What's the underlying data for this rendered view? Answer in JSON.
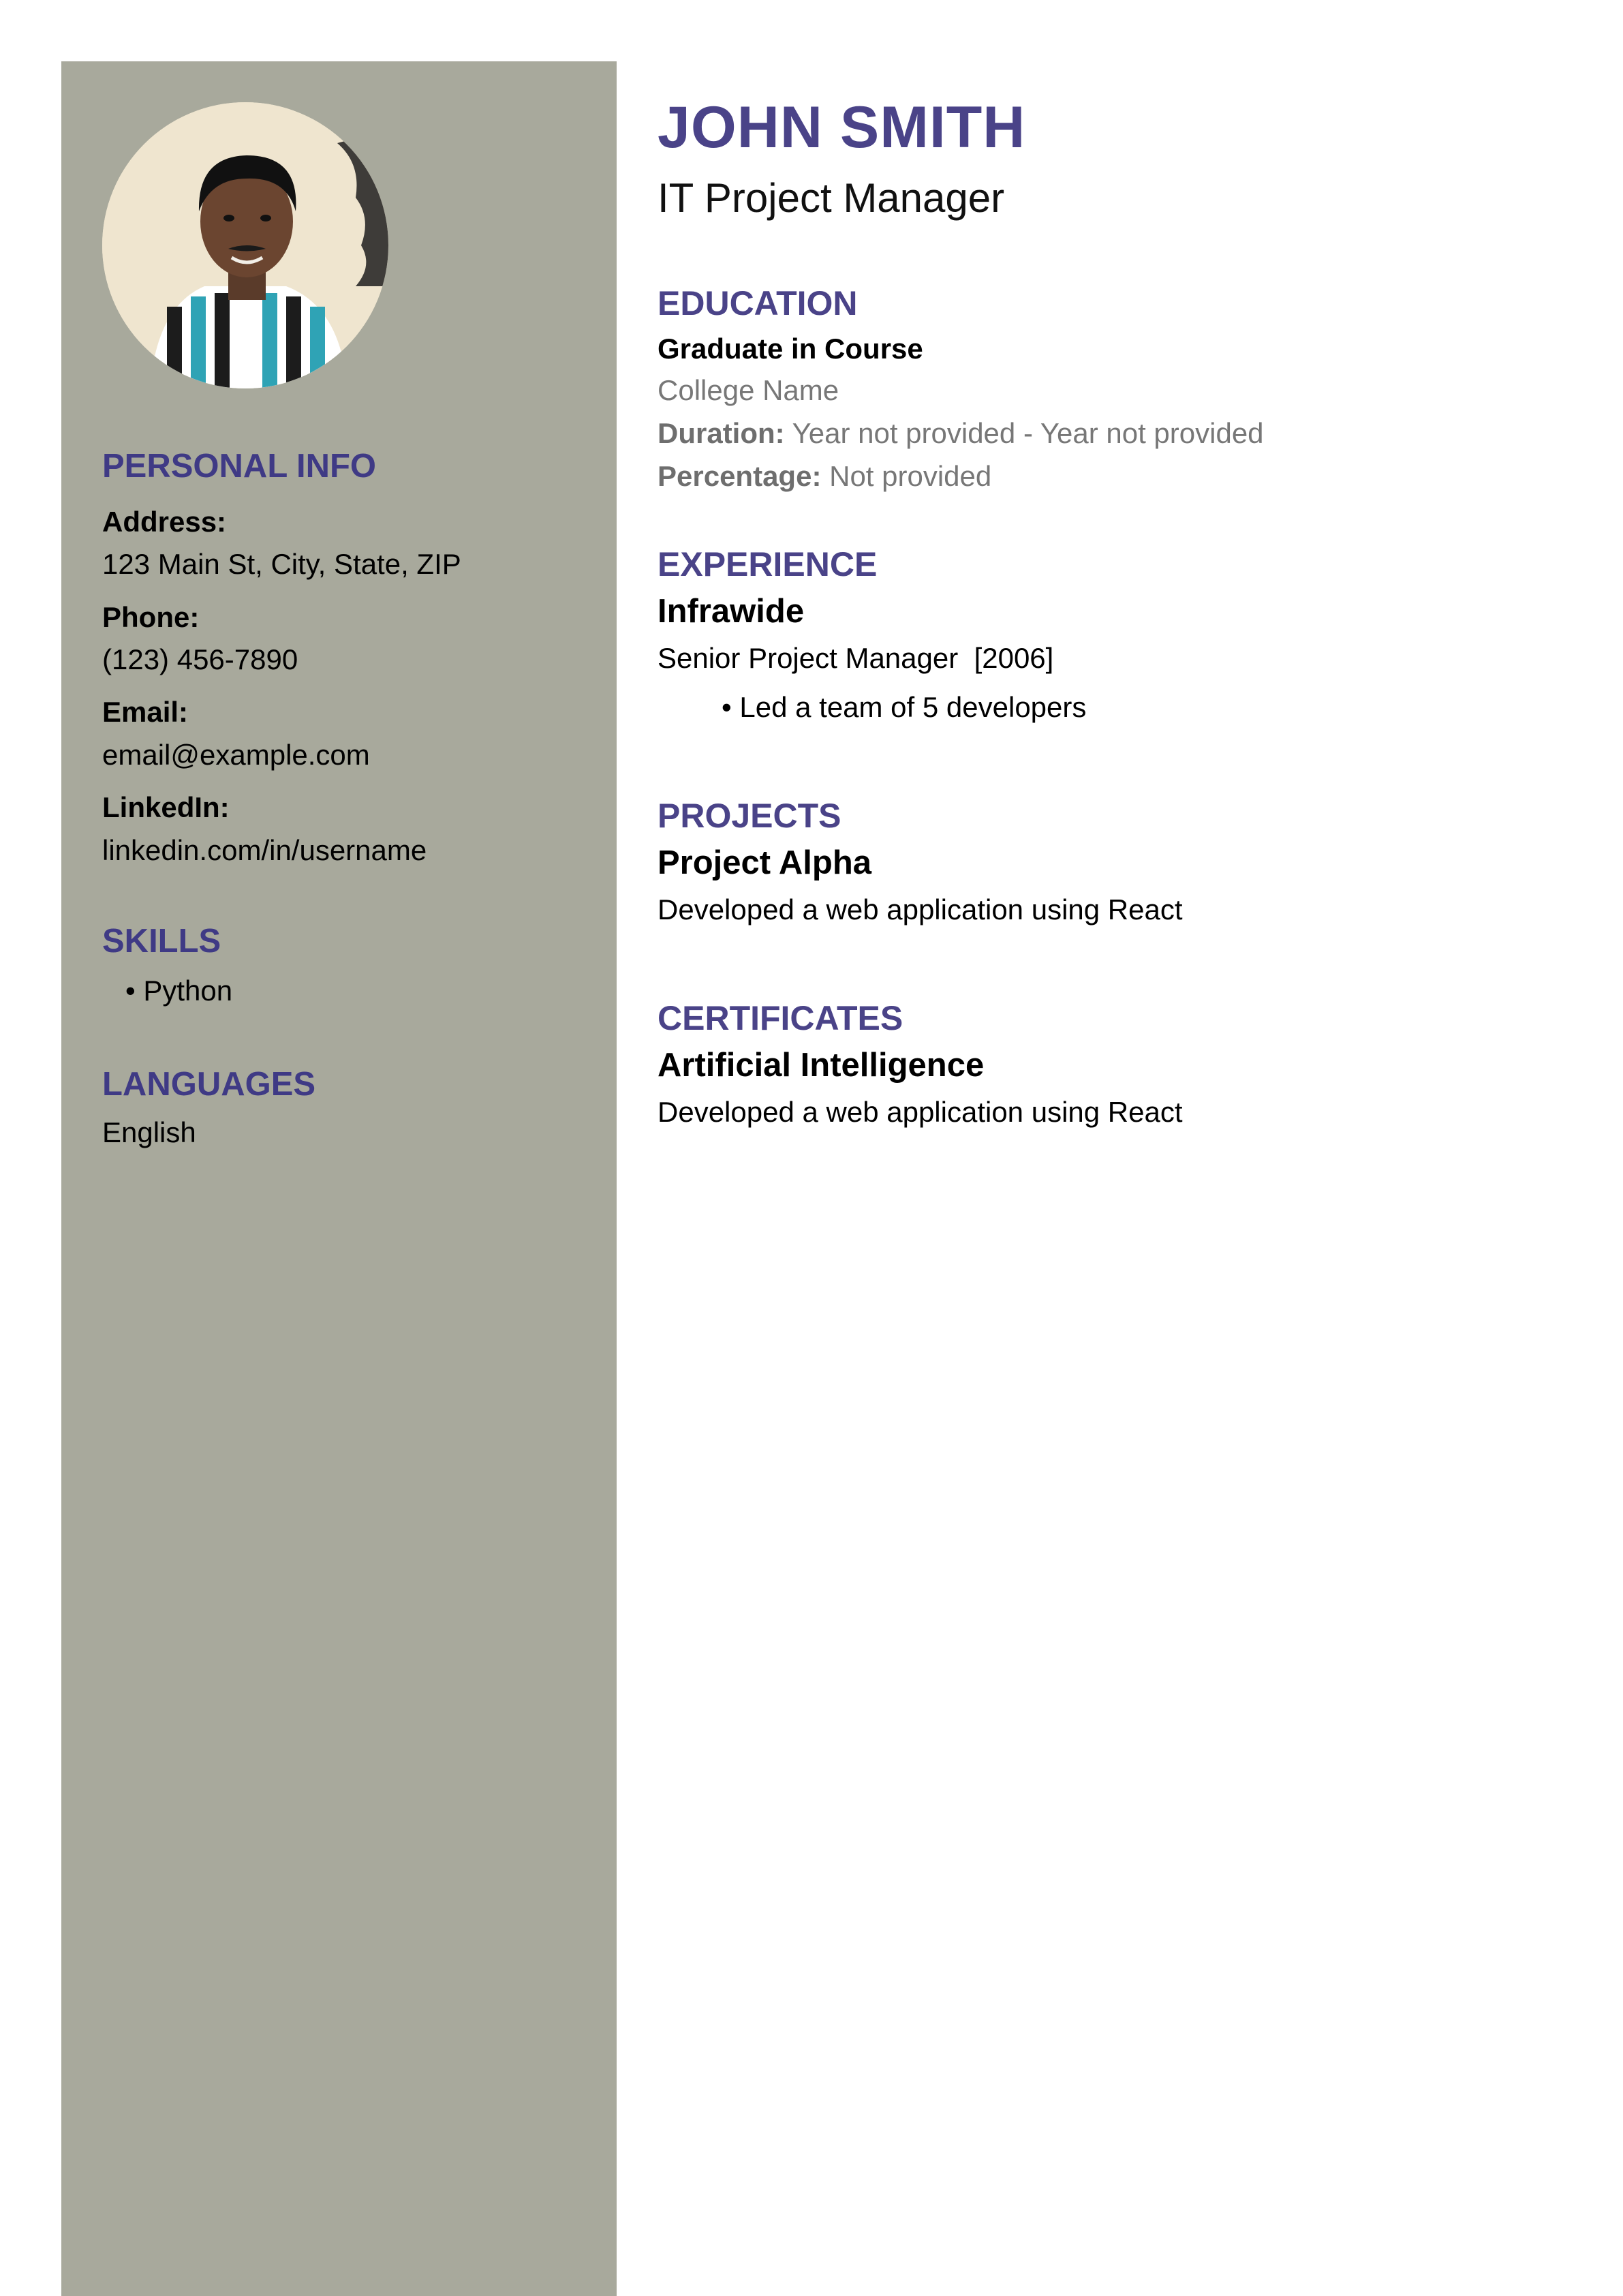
{
  "sidebar": {
    "personal_info": {
      "heading": "PERSONAL INFO",
      "address_label": "Address:",
      "address": "123 Main St, City, State, ZIP",
      "phone_label": "Phone:",
      "phone": "(123) 456-7890",
      "email_label": "Email:",
      "email": "email@example.com",
      "linkedin_label": "LinkedIn:",
      "linkedin": "linkedin.com/in/username"
    },
    "skills": {
      "heading": "SKILLS",
      "items": [
        "• Python"
      ]
    },
    "languages": {
      "heading": "LANGUAGES",
      "items": [
        "English"
      ]
    }
  },
  "header": {
    "name": "JOHN SMITH",
    "title": "IT Project Manager"
  },
  "education": {
    "heading": "EDUCATION",
    "degree": "Graduate in Course",
    "college": "College Name",
    "duration_label": "Duration:",
    "duration": "Year not provided - Year not provided",
    "percentage_label": "Percentage:",
    "percentage": "Not provided"
  },
  "experience": {
    "heading": "EXPERIENCE",
    "company": "Infrawide",
    "role_line": "Senior Project Manager  [2006]",
    "bullets": [
      "• Led a team of 5 developers"
    ]
  },
  "projects": {
    "heading": "PROJECTS",
    "name": "Project Alpha",
    "description": "Developed a web application using React"
  },
  "certificates": {
    "heading": "CERTIFICATES",
    "name": "Artificial Intelligence",
    "description": "Developed a web application using React"
  },
  "colors": {
    "sidebar_bg": "#a8a99c",
    "accent": "#4a4388"
  }
}
